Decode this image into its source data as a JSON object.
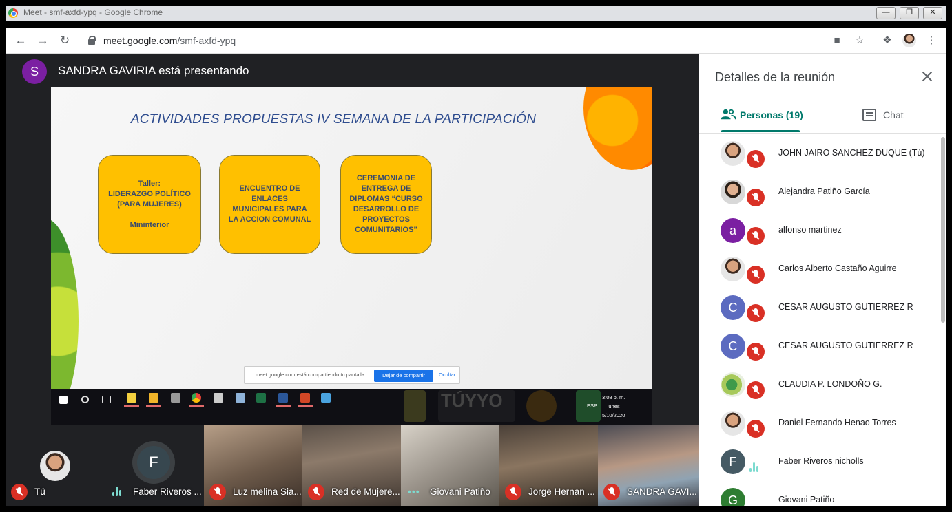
{
  "window": {
    "title": "Meet - smf-axfd-ypq - Google Chrome",
    "buttons": {
      "minimize": "—",
      "restore": "❐",
      "close": "✕"
    }
  },
  "browser": {
    "url_host": "meet.google.com",
    "url_path": "/smf-axfd-ypq"
  },
  "meeting": {
    "presenter_initial": "S",
    "presenter_text": "SANDRA GAVIRIA está presentando"
  },
  "slide": {
    "title": "ACTIVIDADES PROPUESTAS IV SEMANA DE LA PARTICIPACIÓN",
    "cards": [
      "Taller:\nLIDERAZGO POLÍTICO\n(PARA MUJERES)\n\nMininterior",
      "ENCUENTRO DE\nENLACES\nMUNICIPALES PARA\nLA ACCION COMUNAL",
      "CEREMONIA DE\nENTREGA DE\nDIPLOMAS “CURSO\nDESARROLLO DE\nPROYECTOS\nCOMUNITARIOS”"
    ],
    "share_bar": {
      "text": "meet.google.com está compartiendo tu pantalla.",
      "stop_label": "Dejar de compartir",
      "hide_label": "Ocultar"
    },
    "taskbar": {
      "lang": "ESP",
      "time": "3:08 p. m.",
      "day": "lunes",
      "date": "5/10/2020",
      "logo_text": "TÚYYO"
    }
  },
  "tiles": [
    {
      "name": "Tú",
      "muted": true
    },
    {
      "name": "Faber Riveros ...",
      "initial": "F",
      "speaking": true
    },
    {
      "name": "Luz melina Sia...",
      "muted": true
    },
    {
      "name": "Red de Mujere...",
      "muted": true
    },
    {
      "name": "Giovani Patiño",
      "dots": true
    },
    {
      "name": "Jorge Hernan ...",
      "muted": true
    },
    {
      "name": "SANDRA GAVI...",
      "muted": true
    }
  ],
  "panel": {
    "title": "Detalles de la reunión",
    "tab_people": "Personas (19)",
    "tab_chat": "Chat",
    "participants": [
      {
        "name": "JOHN JAIRO SANCHEZ DUQUE (Tú)",
        "avatar": "photo",
        "muted": true
      },
      {
        "name": "Alejandra Patiño García",
        "avatar": "photo",
        "muted": true
      },
      {
        "name": "alfonso martinez",
        "initial": "a",
        "color": "#7b1fa2",
        "muted": true
      },
      {
        "name": "Carlos Alberto Castaño Aguirre",
        "avatar": "photo",
        "muted": true
      },
      {
        "name": "CESAR AUGUSTO GUTIERREZ R",
        "initial": "C",
        "color": "#5c6bc0",
        "muted": true
      },
      {
        "name": "CESAR AUGUSTO GUTIERREZ R",
        "initial": "C",
        "color": "#5c6bc0",
        "muted": true
      },
      {
        "name": "CLAUDIA P. LONDOÑO G.",
        "avatar": "photo",
        "muted": true
      },
      {
        "name": "Daniel Fernando Henao Torres",
        "avatar": "photo",
        "muted": true
      },
      {
        "name": "Faber Riveros nicholls",
        "initial": "F",
        "color": "#455a64",
        "speaking": true
      },
      {
        "name": "Giovani Patiño",
        "initial": "G",
        "color": "#2e7d32",
        "speaking": true
      }
    ]
  }
}
